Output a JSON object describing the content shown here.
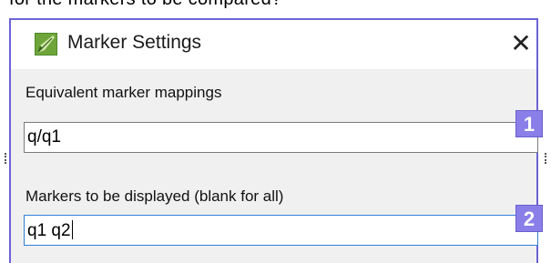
{
  "background": {
    "partial_text": "for the markers to be compared?"
  },
  "dialog": {
    "title": "Marker Settings",
    "icon": "leaf-marker-app-icon",
    "close_glyph": "✕",
    "border_color": "#6b63d6"
  },
  "fields": [
    {
      "label": "Equivalent marker mappings",
      "value": "q/q1",
      "badge": "1",
      "focused": false
    },
    {
      "label": "Markers to be displayed (blank for all)",
      "value": "q1 q2",
      "badge": "2",
      "focused": true
    }
  ],
  "colors": {
    "badge": "#8a7ee8",
    "focus_border": "#2f7fd6",
    "icon_green": "#4f8a2a"
  }
}
